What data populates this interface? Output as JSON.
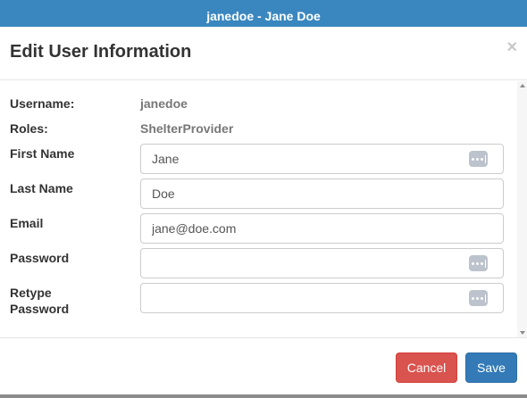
{
  "window": {
    "title": "janedoe - Jane Doe"
  },
  "modal": {
    "title": "Edit User Information",
    "close_symbol": "×"
  },
  "fields": {
    "username": {
      "label": "Username:",
      "value": "janedoe"
    },
    "roles": {
      "label": "Roles:",
      "value": "ShelterProvider"
    },
    "first_name": {
      "label": "First Name",
      "value": "Jane",
      "placeholder": ""
    },
    "last_name": {
      "label": "Last Name",
      "value": "Doe",
      "placeholder": ""
    },
    "email": {
      "label": "Email",
      "value": "jane@doe.com",
      "placeholder": ""
    },
    "password": {
      "label": "Password",
      "value": "",
      "placeholder": ""
    },
    "retype_password": {
      "label_line1": "Retype",
      "label_line2": "Password",
      "value": "",
      "placeholder": ""
    }
  },
  "icons": {
    "password_manager": "password-manager-icon",
    "close": "close-icon"
  },
  "footer": {
    "cancel_label": "Cancel",
    "save_label": "Save"
  },
  "colors": {
    "header_bar": "#3a87c0",
    "cancel": "#d9534f",
    "save": "#337ab7"
  }
}
